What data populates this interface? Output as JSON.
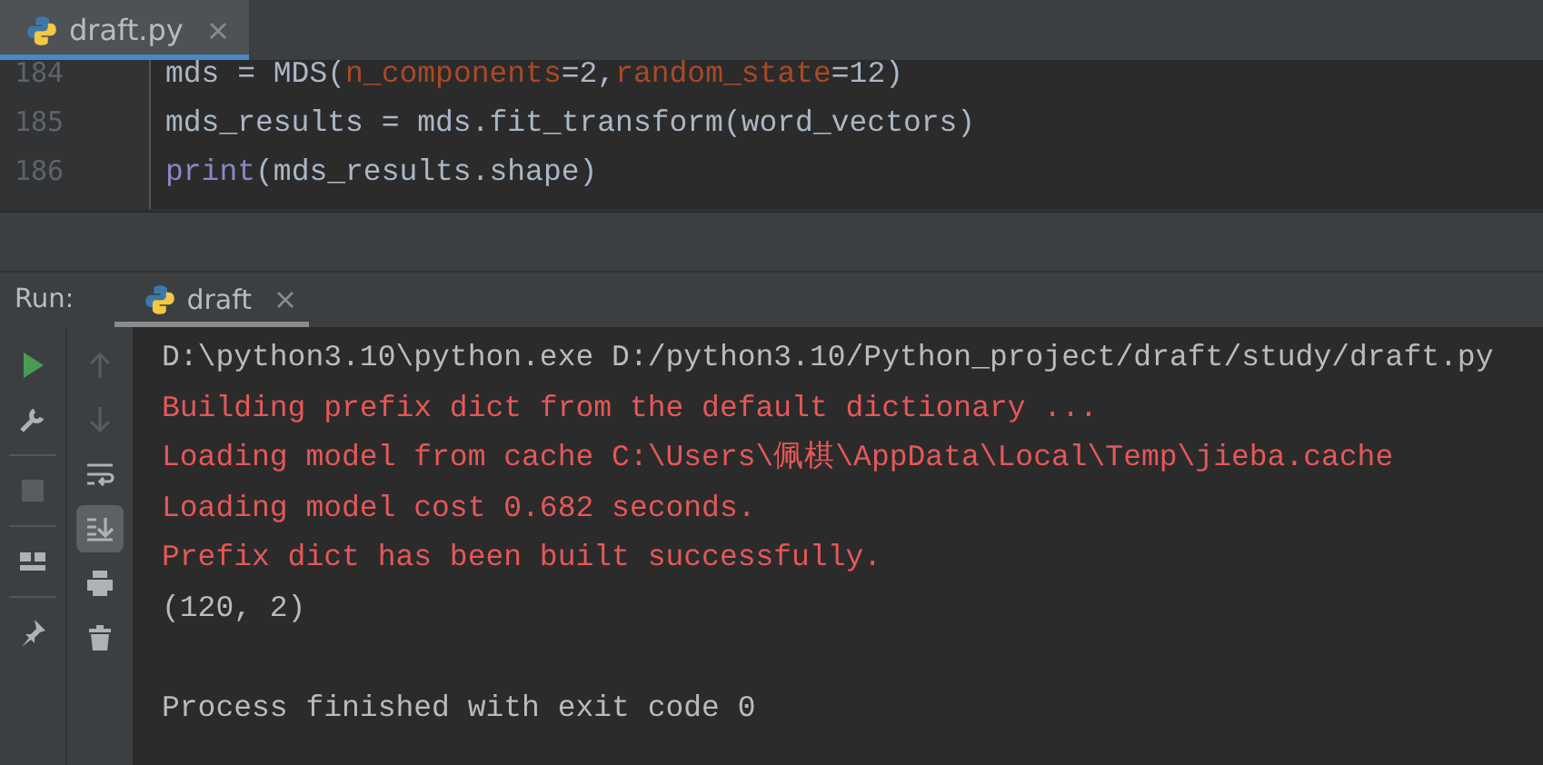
{
  "editor_tab": {
    "label": "draft.py",
    "selected": true
  },
  "editor": {
    "lines": [
      {
        "number": "184",
        "tokens": [
          {
            "kind": "plain",
            "text": "mds = MDS("
          },
          {
            "kind": "param",
            "text": "n_components"
          },
          {
            "kind": "plain",
            "text": "=2,"
          },
          {
            "kind": "param",
            "text": "random_state"
          },
          {
            "kind": "plain",
            "text": "=12)"
          }
        ]
      },
      {
        "number": "185",
        "tokens": [
          {
            "kind": "plain",
            "text": "mds_results = mds.fit_transform(word_vectors)"
          }
        ]
      },
      {
        "number": "186",
        "tokens": [
          {
            "kind": "builtin",
            "text": "print"
          },
          {
            "kind": "plain",
            "text": "(mds_results.shape)"
          }
        ]
      }
    ]
  },
  "run_panel": {
    "label": "Run:",
    "tab": {
      "label": "draft",
      "selected": true
    }
  },
  "left_toolbar": [
    {
      "kind": "run",
      "disabled": false
    },
    {
      "kind": "wrench",
      "disabled": false
    },
    {
      "kind": "stop",
      "disabled": true
    },
    {
      "kind": "layout",
      "disabled": false
    },
    {
      "kind": "pin",
      "disabled": false
    }
  ],
  "console_toolbar": [
    {
      "kind": "up",
      "disabled": true,
      "selected": false
    },
    {
      "kind": "down",
      "disabled": true,
      "selected": false
    },
    {
      "kind": "wrap",
      "disabled": false,
      "selected": false
    },
    {
      "kind": "scroll-end",
      "disabled": false,
      "selected": true
    },
    {
      "kind": "print",
      "disabled": false,
      "selected": false
    },
    {
      "kind": "trash",
      "disabled": false,
      "selected": false
    }
  ],
  "console": [
    {
      "kind": "stdout",
      "text": "D:\\python3.10\\python.exe D:/python3.10/Python_project/draft/study/draft.py"
    },
    {
      "kind": "stderr",
      "text": "Building prefix dict from the default dictionary ..."
    },
    {
      "kind": "stderr",
      "text": "Loading model from cache C:\\Users\\佩棋\\AppData\\Local\\Temp\\jieba.cache"
    },
    {
      "kind": "stderr",
      "text": "Loading model cost 0.682 seconds."
    },
    {
      "kind": "stderr",
      "text": "Prefix dict has been built successfully."
    },
    {
      "kind": "stdout",
      "text": "(120, 2)"
    },
    {
      "kind": "blank"
    },
    {
      "kind": "stdout",
      "text": "Process finished with exit code 0"
    }
  ]
}
